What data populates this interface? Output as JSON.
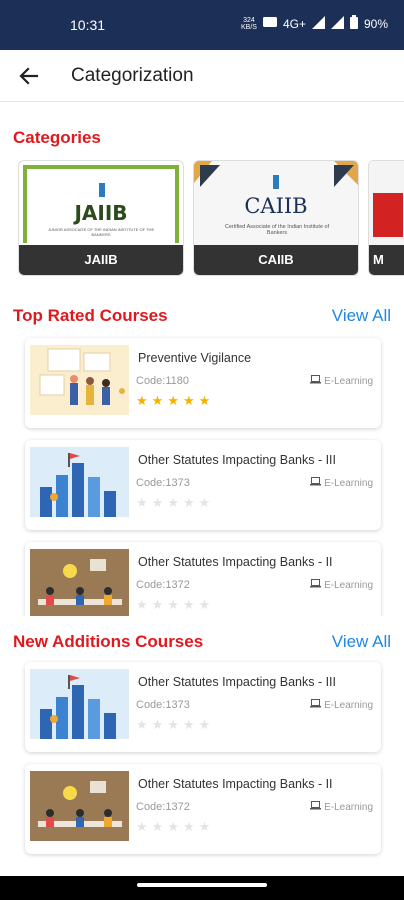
{
  "status_bar": {
    "time": "10:31",
    "network": "4G+",
    "battery": "90%",
    "speed": "324\nKB/S"
  },
  "app_bar": {
    "title": "Categorization",
    "back_icon": "arrow-back-icon"
  },
  "categories": {
    "heading": "Categories",
    "items": [
      {
        "label": "JAIIB",
        "logo_text": "JAIIB",
        "logo_subtext": "JUNIOR ASSOCIATE OF THE INDIAN INSTITUTE OF THE BANKERS"
      },
      {
        "label": "CAIIB",
        "logo_text": "CAIIB",
        "logo_subtext": "Certified Associate of the Indian Institute of Bankers"
      },
      {
        "label": "M"
      }
    ]
  },
  "top_rated": {
    "heading": "Top Rated Courses",
    "view_all": "View All",
    "courses": [
      {
        "name": "Preventive Vigilance",
        "code": "Code:1180",
        "type": "E-Learning",
        "rating": 5
      },
      {
        "name": "Other Statutes Impacting Banks - III",
        "code": "Code:1373",
        "type": "E-Learning",
        "rating": 0
      },
      {
        "name": "Other Statutes Impacting Banks - II",
        "code": "Code:1372",
        "type": "E-Learning",
        "rating": 0
      }
    ]
  },
  "new_additions": {
    "heading": "New Additions Courses",
    "view_all": "View All",
    "courses": [
      {
        "name": "Other Statutes Impacting Banks - III",
        "code": "Code:1373",
        "type": "E-Learning",
        "rating": 0
      },
      {
        "name": "Other Statutes Impacting Banks - II",
        "code": "Code:1372",
        "type": "E-Learning",
        "rating": 0
      }
    ]
  },
  "colors": {
    "status_bar": "#1b2f57",
    "section_title": "#e0191e",
    "view_all": "#1e88e5",
    "star": "#f5b100"
  }
}
